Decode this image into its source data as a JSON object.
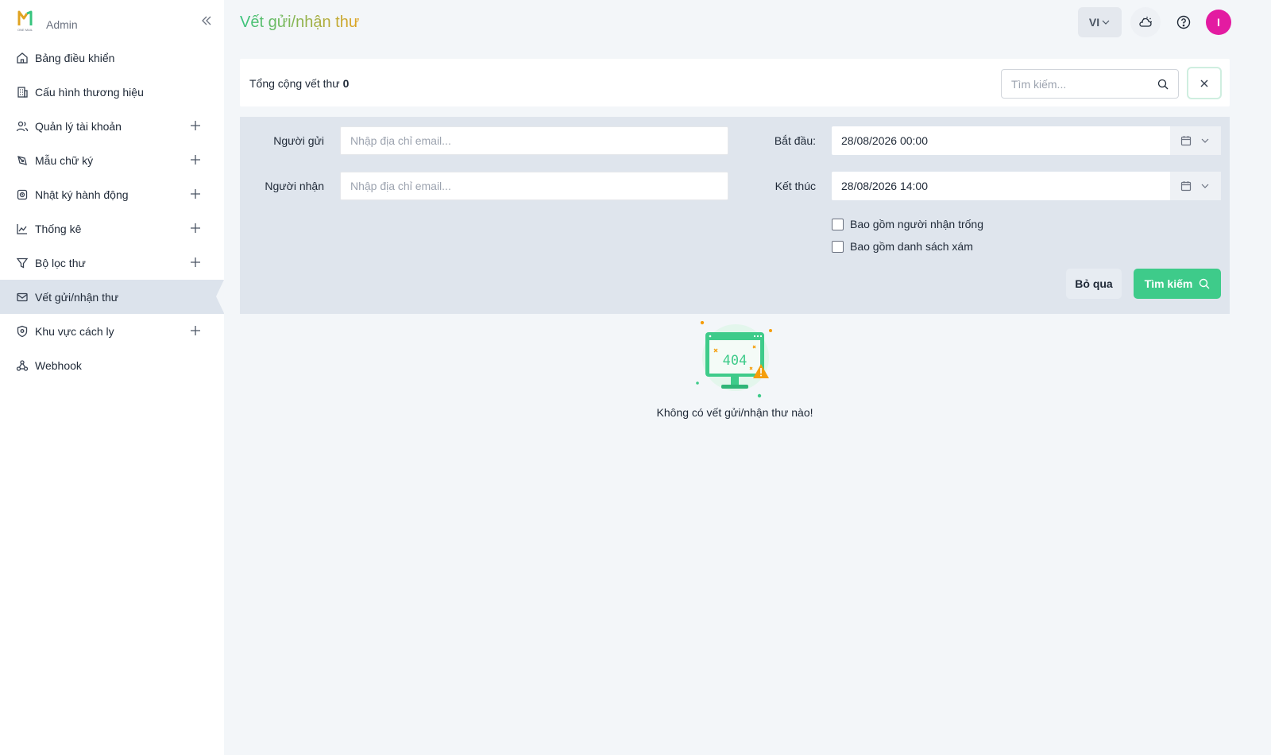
{
  "brand": {
    "logo_text": "ONE MAIL",
    "name": "Admin"
  },
  "sidebar": {
    "items": [
      {
        "label": "Bảng điều khiển",
        "icon": "home-icon",
        "expandable": false
      },
      {
        "label": "Cấu hình thương hiệu",
        "icon": "building-icon",
        "expandable": false
      },
      {
        "label": "Quản lý tài khoản",
        "icon": "users-icon",
        "expandable": true
      },
      {
        "label": "Mẫu chữ ký",
        "icon": "pen-icon",
        "expandable": true
      },
      {
        "label": "Nhật ký hành động",
        "icon": "log-icon",
        "expandable": true
      },
      {
        "label": "Thống kê",
        "icon": "chart-icon",
        "expandable": true
      },
      {
        "label": "Bộ lọc thư",
        "icon": "filter-icon",
        "expandable": true
      },
      {
        "label": "Vết gửi/nhận thư",
        "icon": "mail-icon",
        "expandable": false,
        "active": true
      },
      {
        "label": "Khu vực cách ly",
        "icon": "shield-icon",
        "expandable": true
      },
      {
        "label": "Webhook",
        "icon": "webhook-icon",
        "expandable": false
      }
    ]
  },
  "header": {
    "title": "Vết gửi/nhận thư",
    "language": "VI",
    "avatar_initial": "I"
  },
  "summary": {
    "total_label": "Tổng cộng vết thư",
    "total_count": "0",
    "search_placeholder": "Tìm kiếm..."
  },
  "filter": {
    "sender_label": "Người gửi",
    "sender_placeholder": "Nhập địa chỉ email...",
    "recipient_label": "Người nhận",
    "recipient_placeholder": "Nhập địa chỉ email...",
    "start_label": "Bắt đầu:",
    "start_value": "28/08/2026 00:00",
    "end_label": "Kết thúc",
    "end_value": "28/08/2026 14:00",
    "include_empty_recipient": "Bao gồm người nhận trống",
    "include_greylist": "Bao gồm danh sách xám",
    "skip_button": "Bỏ qua",
    "search_button": "Tìm kiếm"
  },
  "empty": {
    "code": "404",
    "message": "Không có vết gửi/nhận thư nào!"
  },
  "colors": {
    "accent_green": "#3ecb8a",
    "title_gradient_start": "#37c47e",
    "title_gradient_end": "#e0a321",
    "avatar": "#e31ba1",
    "active_nav": "#dce3ec",
    "filter_bg": "#dfe5ed"
  }
}
